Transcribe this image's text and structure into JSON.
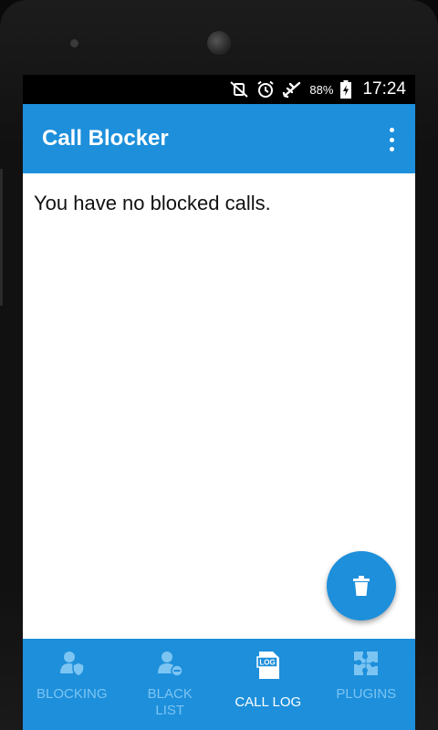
{
  "status_bar": {
    "icons": [
      "vibrate-off-icon",
      "alarm-icon",
      "airplane-icon",
      "battery-charging-icon"
    ],
    "battery": "88%",
    "time": "17:24"
  },
  "app_bar": {
    "title": "Call Blocker",
    "menu_icon": "more-vert-icon"
  },
  "content": {
    "empty_message": "You have no blocked calls."
  },
  "fab": {
    "icon": "trash-icon"
  },
  "bottom_nav": {
    "items": [
      {
        "label": "BLOCKING",
        "icon": "shield-user-icon",
        "active": false
      },
      {
        "label": "BLACK\nLIST",
        "icon": "user-minus-icon",
        "active": false
      },
      {
        "label": "CALL LOG",
        "icon": "log-file-icon",
        "active": true
      },
      {
        "label": "PLUGINS",
        "icon": "puzzle-icon",
        "active": false
      }
    ]
  },
  "colors": {
    "primary": "#1d8fdb",
    "inactive_label": "#7cc4f2",
    "active_label": "#ffffff"
  }
}
